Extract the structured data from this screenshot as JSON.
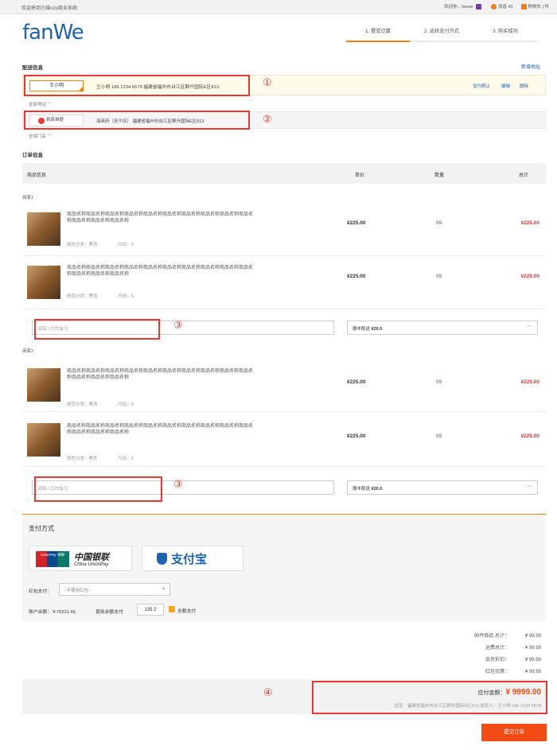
{
  "topbar": {
    "welcome": "欢迎来到方维o2o商业系统",
    "greeting": "欢迎你，fanwe",
    "messages": "消息 43",
    "cart": "购物车 | 件"
  },
  "logo": "fanWe",
  "steps": [
    "1. 提交订单",
    "2. 选择支付方式",
    "3. 购买成功"
  ],
  "delivery": {
    "title": "配送信息",
    "add_link": "新增地址",
    "name": "王小明",
    "address": "王小明 186 1234 5678 福建省福州市台江区群升国际E区813",
    "set_default": "设为默认",
    "edit": "编辑",
    "delete": "删除",
    "all_address": "全部地址",
    "store_name": "到店自提",
    "store_address": "海英府（苏宁店） 福建省福州市台江区群升国际E区813",
    "all_stores": "全部门店"
  },
  "annotations": {
    "a1": "①",
    "a2": "②",
    "a3": "③",
    "a4": "④"
  },
  "order": {
    "title": "订单信息",
    "headers": [
      "商品信息",
      "单价",
      "数量",
      "总计"
    ],
    "shops": [
      {
        "name": "商家1",
        "items": [
          {
            "name": "商品名称商品名称商品名称商品名称商品名称商品名称商品名称商品名称商品名称商品名称商品名称商品名称商品名称",
            "color": "颜色分类：黑色",
            "size": "尺码：S",
            "price": "¥225.00",
            "qty": "99",
            "total": "¥225.00"
          },
          {
            "name": "商品名称商品名称商品名称商品名称商品名称商品名称商品名称商品名称商品名称商品名称商品名称商品名称商品名称",
            "color": "颜色分类：黑色",
            "size": "尺码：S",
            "price": "¥225.00",
            "qty": "99",
            "total": "¥225.00"
          }
        ],
        "note_placeholder": "请输入您的备注",
        "shipping_label": "顺丰配送",
        "shipping_price": "¥20.0"
      },
      {
        "name": "商家2",
        "items": [
          {
            "name": "商品名称商品名称商品名称商品名称商品名称商品名称商品名称商品名称商品名称商品名称商品名称商品名称商品名称",
            "color": "颜色分类：黑色",
            "size": "尺码：S",
            "price": "¥225.00",
            "qty": "99",
            "total": "¥225.00"
          },
          {
            "name": "商品名称商品名称商品名称商品名称商品名称商品名称商品名称商品名称商品名称商品名称商品名称商品名称商品名称",
            "color": "颜色分类：黑色",
            "size": "尺码：S",
            "price": "¥225.00",
            "qty": "99",
            "total": "¥225.00"
          }
        ],
        "note_placeholder": "请输入您的备注",
        "shipping_label": "顺丰配送",
        "shipping_price": "¥20.0"
      }
    ]
  },
  "payment": {
    "title": "支付方式",
    "unionpay_cn": "中国银联",
    "unionpay_en": "China UnionPay",
    "unionpay_badge": "UnionPay 银联",
    "alipay": "支付宝",
    "redpack_label": "红包支付：",
    "redpack_value": "--不使用红包--",
    "balance": "账户余额：￥76221.46",
    "use_balance": "使用余额支付",
    "balance_input": "135.2",
    "full_pay": "全额支付"
  },
  "summary": {
    "rows": [
      [
        "99件商品 总计：",
        "¥ 99.99"
      ],
      [
        "运费总计：",
        "¥ 99.99"
      ],
      [
        "会员折扣：",
        "¥ 99.99"
      ],
      [
        "红包优惠：",
        "¥ 99.99"
      ]
    ],
    "payable_label": "应付金额：",
    "payable_value": "¥ 9999.00",
    "ship_to": "送至：福建省福州市台江区群升国际E区813  收货人：王小明 186 1234 5678"
  },
  "submit": "提交订单",
  "colors": {
    "accent": "#f57f17",
    "red": "#e43a35",
    "blue": "#1e62b0"
  }
}
